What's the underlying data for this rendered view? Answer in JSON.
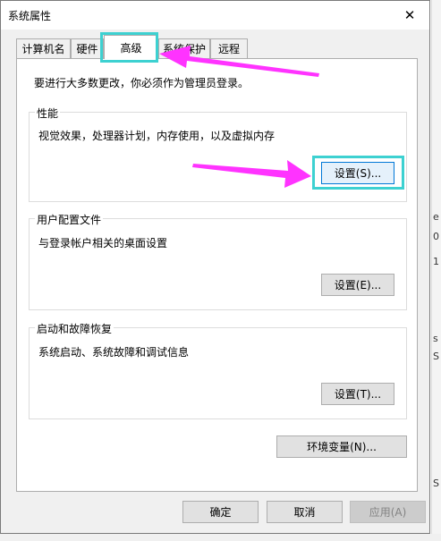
{
  "dialog": {
    "title": "系统属性",
    "close_symbol": "✕",
    "tabs": [
      {
        "label": "计算机名"
      },
      {
        "label": "硬件"
      },
      {
        "label": "高级"
      },
      {
        "label": "系统保护"
      },
      {
        "label": "远程"
      }
    ],
    "active_tab": "高级",
    "admin_note": "要进行大多数更改，你必须作为管理员登录。",
    "performance": {
      "title": "性能",
      "description": "视觉效果，处理器计划，内存使用，以及虚拟内存",
      "button": "设置(S)..."
    },
    "user_profiles": {
      "title": "用户配置文件",
      "description": "与登录帐户相关的桌面设置",
      "button": "设置(E)..."
    },
    "startup_recovery": {
      "title": "启动和故障恢复",
      "description": "系统启动、系统故障和调试信息",
      "button": "设置(T)..."
    },
    "env_button": "环境变量(N)...",
    "ok_button": "确定",
    "cancel_button": "取消",
    "apply_button": "应用(A)"
  },
  "background_fragments": [
    "e",
    "0",
    "1",
    "s",
    "S",
    "S"
  ],
  "annotations": {
    "highlight_color": "#3dd1d1",
    "arrow_color": "#ff33ff"
  }
}
